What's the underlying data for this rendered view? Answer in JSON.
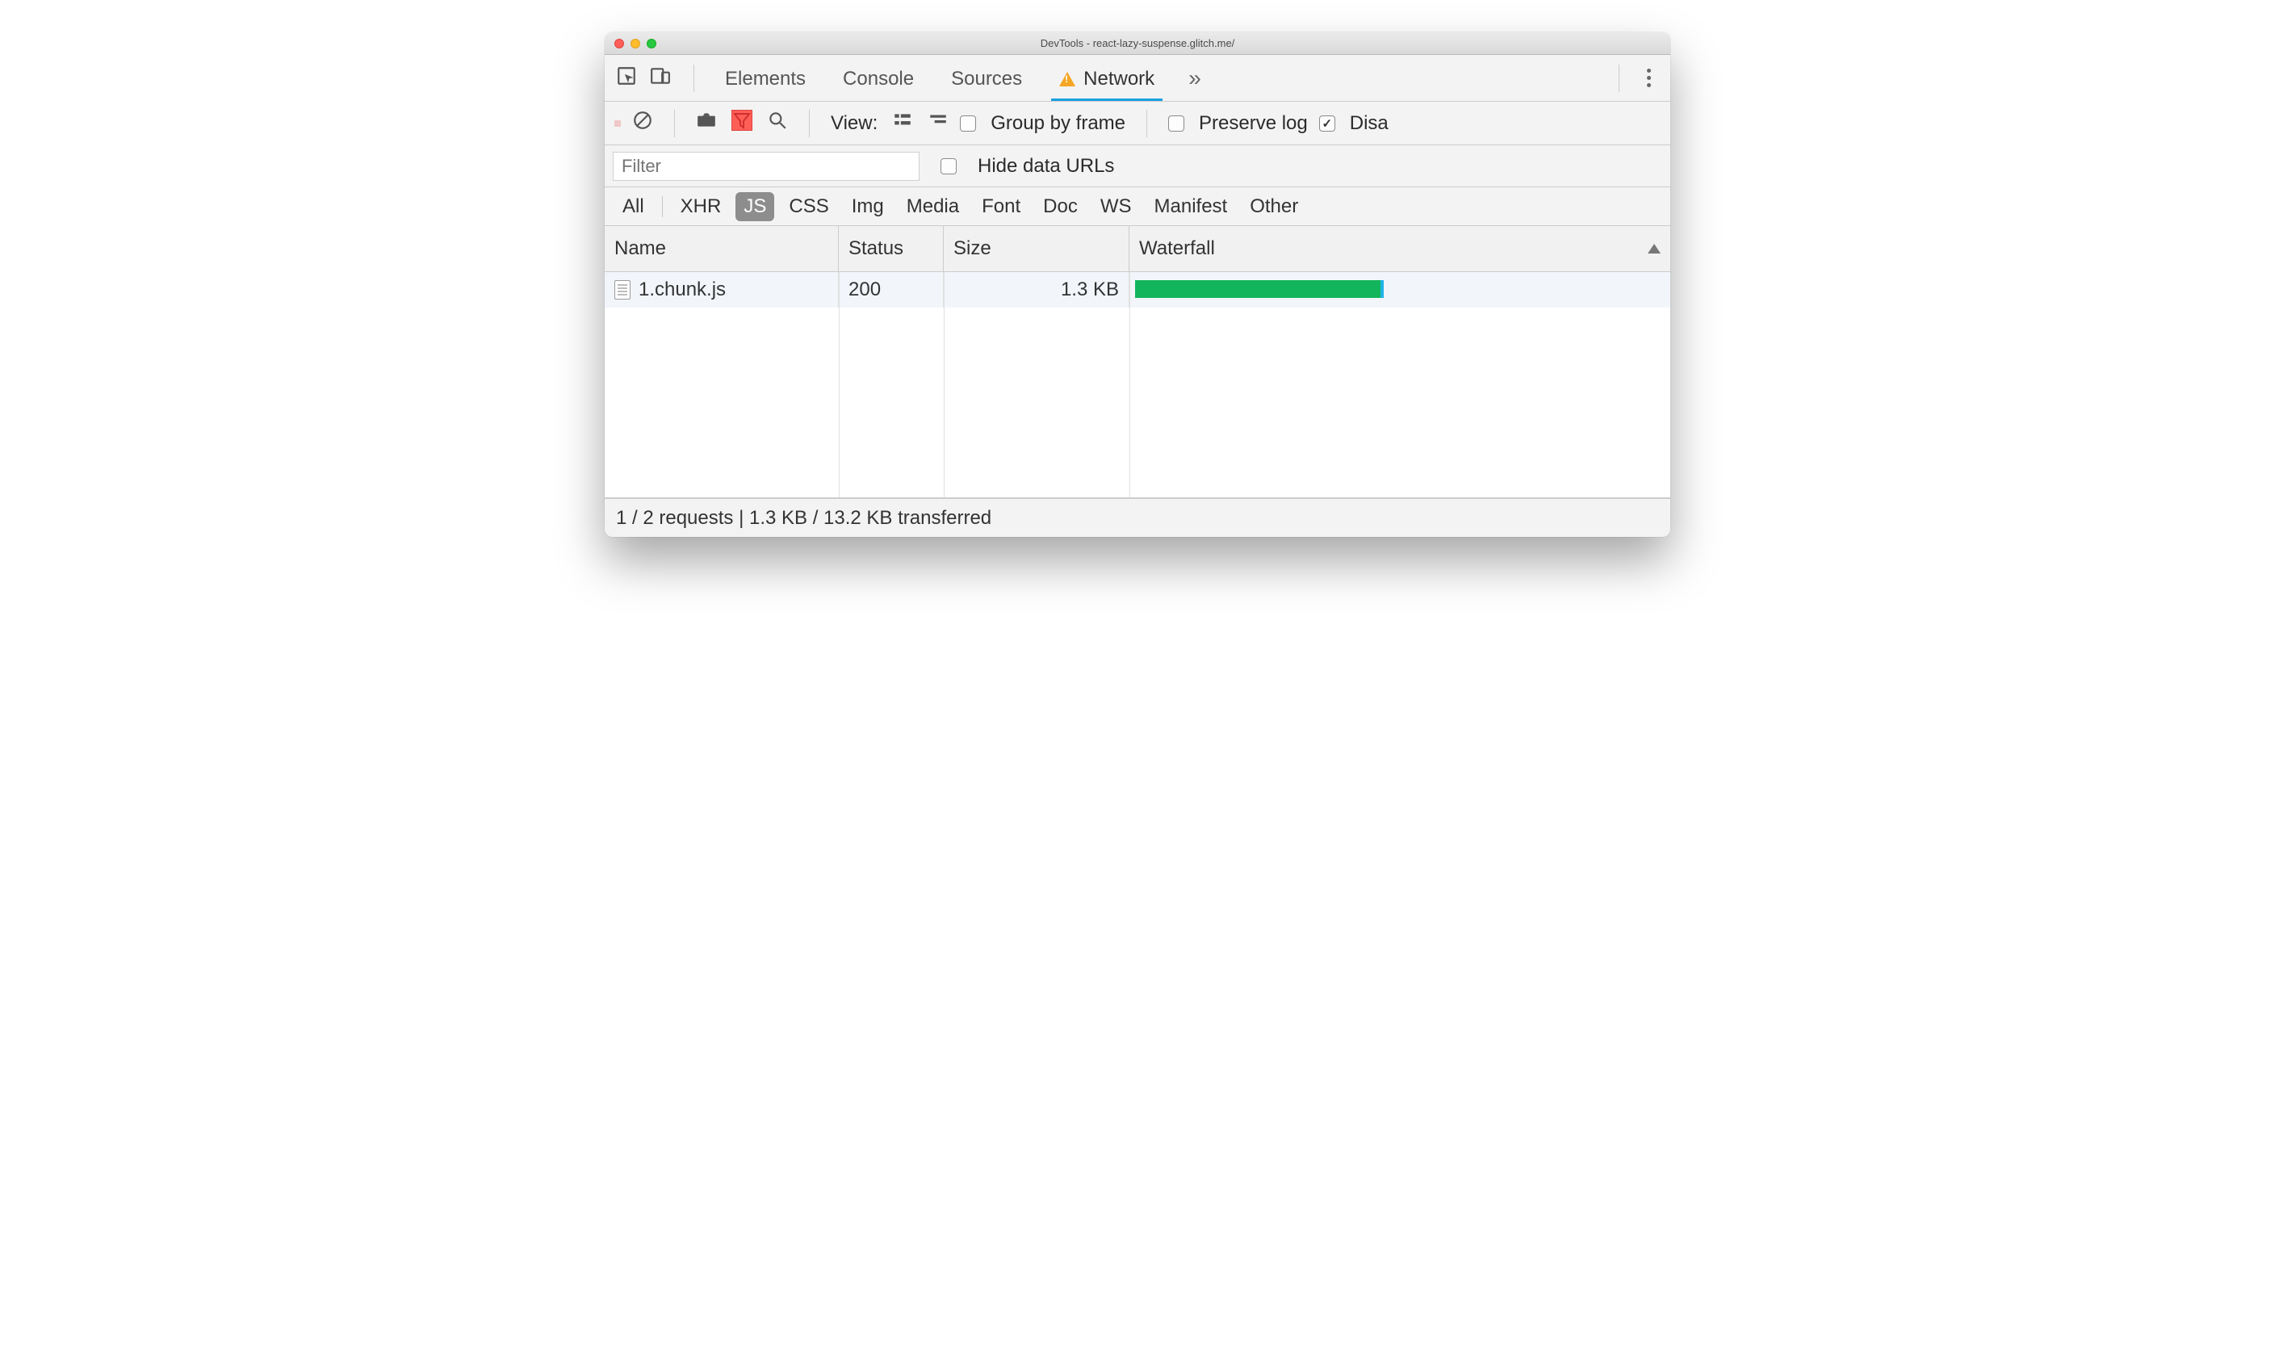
{
  "window": {
    "title": "DevTools - react-lazy-suspense.glitch.me/"
  },
  "tabs": {
    "items": [
      "Elements",
      "Console",
      "Sources",
      "Network"
    ],
    "active": "Network",
    "network_has_warning": true
  },
  "toolbar": {
    "view_label": "View:",
    "group_by_frame_label": "Group by frame",
    "group_by_frame_checked": false,
    "preserve_log_label": "Preserve log",
    "preserve_log_checked": false,
    "disable_cache_label": "Disa",
    "disable_cache_checked": true
  },
  "filter": {
    "placeholder": "Filter",
    "value": "",
    "hide_data_urls_label": "Hide data URLs",
    "hide_data_urls_checked": false
  },
  "types": {
    "items": [
      "All",
      "XHR",
      "JS",
      "CSS",
      "Img",
      "Media",
      "Font",
      "Doc",
      "WS",
      "Manifest",
      "Other"
    ],
    "active": "JS"
  },
  "table": {
    "columns": {
      "name": "Name",
      "status": "Status",
      "size": "Size",
      "waterfall": "Waterfall"
    },
    "sort_column": "waterfall",
    "rows": [
      {
        "name": "1.chunk.js",
        "status": "200",
        "size": "1.3 KB",
        "waterfall": {
          "start_pct": 1,
          "width_pct": 46
        }
      }
    ]
  },
  "statusbar": {
    "text": "1 / 2 requests | 1.3 KB / 13.2 KB transferred"
  }
}
